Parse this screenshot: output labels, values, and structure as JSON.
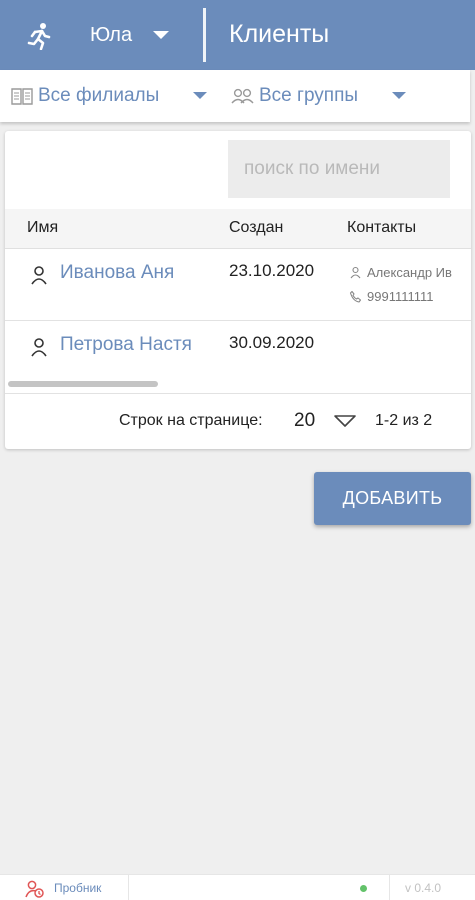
{
  "colors": {
    "accent": "#6b8cbb",
    "status_online": "#63c26a"
  },
  "header": {
    "app_icon": "running-person-icon",
    "user_name": "Юла",
    "title": "Клиенты"
  },
  "filters": {
    "branches": {
      "icon": "book-icon",
      "label": "Все филиалы"
    },
    "groups": {
      "icon": "group-icon",
      "label": "Все группы"
    }
  },
  "search": {
    "placeholder": "поиск по имени",
    "value": ""
  },
  "table": {
    "columns": [
      "Имя",
      "Создан",
      "Контакты"
    ],
    "rows": [
      {
        "name": "Иванова Аня",
        "created": "23.10.2020",
        "contact_name": "Александр Ив",
        "contact_phone": "9991111111"
      },
      {
        "name": "Петрова Настя",
        "created": "30.09.2020",
        "contact_name": "",
        "contact_phone": ""
      }
    ]
  },
  "pagination": {
    "rows_label": "Строк на странице:",
    "rows_value": "20",
    "range": "1-2 из 2"
  },
  "actions": {
    "add_label": "ДОБАВИТЬ"
  },
  "statusbar": {
    "trial_label": "Пробник",
    "version": "v 0.4.0"
  }
}
